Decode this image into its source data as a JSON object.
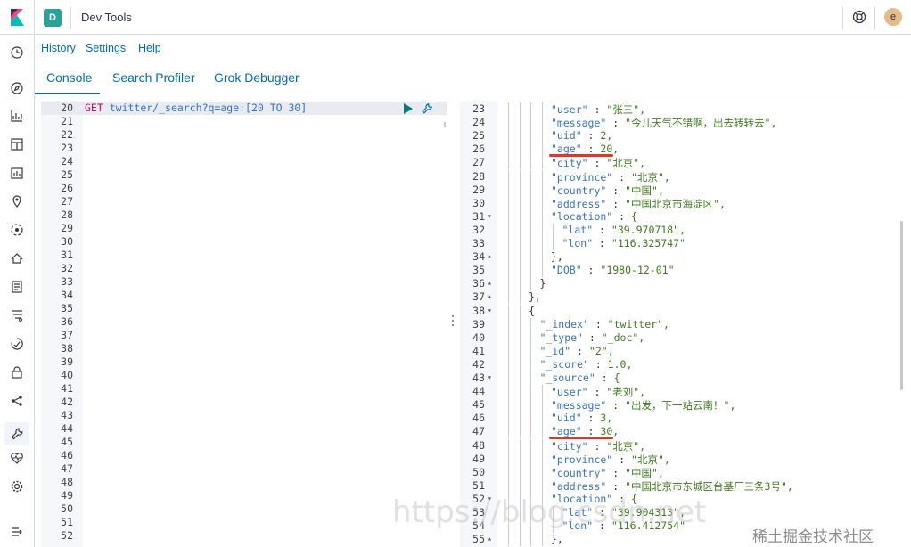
{
  "header": {
    "space_initial": "D",
    "app_title": "Dev Tools",
    "user_initial": "e"
  },
  "topmenu": {
    "history": "History",
    "settings": "Settings",
    "help": "Help"
  },
  "tabs": [
    "Console",
    "Search Profiler",
    "Grok Debugger"
  ],
  "request": {
    "method": "GET",
    "path": "twitter/_search?q=age:[20 TO 30]",
    "line_numbers": [
      "20",
      "21",
      "22",
      "23",
      "24",
      "25",
      "26",
      "27",
      "28",
      "29",
      "30",
      "31",
      "32",
      "33",
      "34",
      "35",
      "36",
      "37",
      "38",
      "39",
      "40",
      "41",
      "42",
      "43",
      "44",
      "45",
      "46",
      "47",
      "48",
      "49",
      "50",
      "51",
      "52"
    ]
  },
  "response": {
    "lines": [
      {
        "n": "23",
        "fold": "",
        "depth": 4,
        "text": "\"user\" : \"张三\","
      },
      {
        "n": "24",
        "fold": "",
        "depth": 4,
        "text": "\"message\" : \"今儿天气不错啊，出去转转去\","
      },
      {
        "n": "25",
        "fold": "",
        "depth": 4,
        "text": "\"uid\" : 2,"
      },
      {
        "n": "26",
        "fold": "",
        "depth": 4,
        "text": "\"age\" : 20,"
      },
      {
        "n": "27",
        "fold": "",
        "depth": 4,
        "text": "\"city\" : \"北京\","
      },
      {
        "n": "28",
        "fold": "",
        "depth": 4,
        "text": "\"province\" : \"北京\","
      },
      {
        "n": "29",
        "fold": "",
        "depth": 4,
        "text": "\"country\" : \"中国\","
      },
      {
        "n": "30",
        "fold": "",
        "depth": 4,
        "text": "\"address\" : \"中国北京市海淀区\","
      },
      {
        "n": "31",
        "fold": "▾",
        "depth": 4,
        "text": "\"location\" : {"
      },
      {
        "n": "32",
        "fold": "",
        "depth": 5,
        "text": "\"lat\" : \"39.970718\","
      },
      {
        "n": "33",
        "fold": "",
        "depth": 5,
        "text": "\"lon\" : \"116.325747\""
      },
      {
        "n": "34",
        "fold": "▴",
        "depth": 4,
        "text": "},"
      },
      {
        "n": "35",
        "fold": "",
        "depth": 4,
        "text": "\"DOB\" : \"1980-12-01\""
      },
      {
        "n": "36",
        "fold": "▴",
        "depth": 3,
        "text": "}"
      },
      {
        "n": "37",
        "fold": "▴",
        "depth": 2,
        "text": "},"
      },
      {
        "n": "38",
        "fold": "▾",
        "depth": 2,
        "text": "{"
      },
      {
        "n": "39",
        "fold": "",
        "depth": 3,
        "text": "\"_index\" : \"twitter\","
      },
      {
        "n": "40",
        "fold": "",
        "depth": 3,
        "text": "\"_type\" : \"_doc\","
      },
      {
        "n": "41",
        "fold": "",
        "depth": 3,
        "text": "\"_id\" : \"2\","
      },
      {
        "n": "42",
        "fold": "",
        "depth": 3,
        "text": "\"_score\" : 1.0,"
      },
      {
        "n": "43",
        "fold": "▾",
        "depth": 3,
        "text": "\"_source\" : {"
      },
      {
        "n": "44",
        "fold": "",
        "depth": 4,
        "text": "\"user\" : \"老刘\","
      },
      {
        "n": "45",
        "fold": "",
        "depth": 4,
        "text": "\"message\" : \"出发，下一站云南！\","
      },
      {
        "n": "46",
        "fold": "",
        "depth": 4,
        "text": "\"uid\" : 3,"
      },
      {
        "n": "47",
        "fold": "",
        "depth": 4,
        "text": "\"age\" : 30,"
      },
      {
        "n": "48",
        "fold": "",
        "depth": 4,
        "text": "\"city\" : \"北京\","
      },
      {
        "n": "49",
        "fold": "",
        "depth": 4,
        "text": "\"province\" : \"北京\","
      },
      {
        "n": "50",
        "fold": "",
        "depth": 4,
        "text": "\"country\" : \"中国\","
      },
      {
        "n": "51",
        "fold": "",
        "depth": 4,
        "text": "\"address\" : \"中国北京市东城区台基厂三条3号\","
      },
      {
        "n": "52",
        "fold": "▾",
        "depth": 4,
        "text": "\"location\" : {"
      },
      {
        "n": "53",
        "fold": "",
        "depth": 5,
        "text": "\"lat\" : \"39.904313\","
      },
      {
        "n": "54",
        "fold": "",
        "depth": 5,
        "text": "\"lon\" : \"116.412754\""
      },
      {
        "n": "55",
        "fold": "▴",
        "depth": 4,
        "text": "},"
      }
    ],
    "highlighted_lines": [
      "26",
      "47"
    ]
  },
  "watermark": "https://blog.csdn.net",
  "watermark2": "稀土掘金技术社区"
}
